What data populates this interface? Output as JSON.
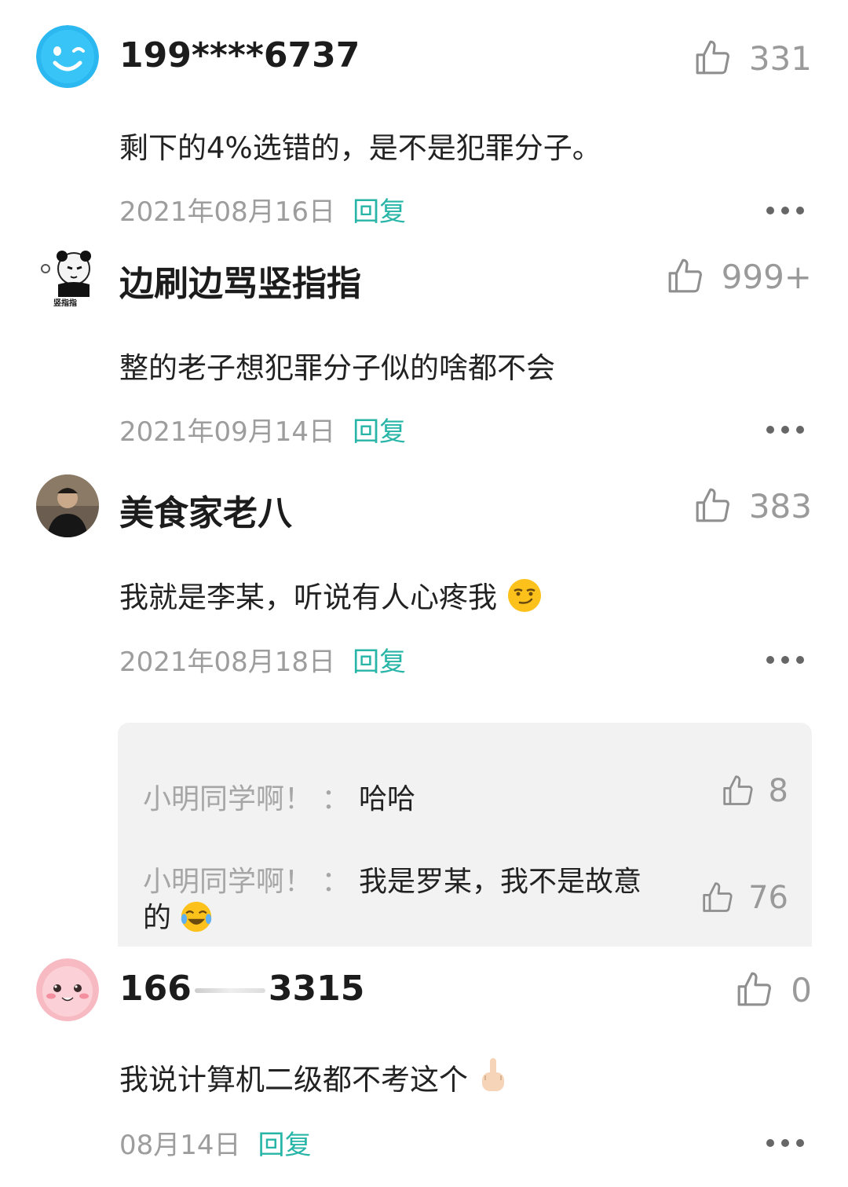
{
  "colors": {
    "reply": "#27b5a7",
    "meta": "#9d9d9d",
    "like": "#9a9a9a",
    "subbox": "#f2f2f2"
  },
  "comments": [
    {
      "username": "199****6737",
      "likes": "331",
      "text": "剩下的4%选错的，是不是犯罪分子。",
      "date": "2021年08月16日",
      "reply": "回复",
      "avatar_icon": "blue-smiley-avatar"
    },
    {
      "username": "边刷边骂竖指指",
      "likes": "999+",
      "text": "整的老子想犯罪分子似的啥都不会",
      "date": "2021年09月14日",
      "reply": "回复",
      "avatar_icon": "panda-meme-avatar",
      "avatar_caption": "竖指指"
    },
    {
      "username": "美食家老八",
      "likes": "383",
      "text": "我就是李某，听说有人心疼我",
      "date": "2021年08月18日",
      "reply": "回复",
      "avatar_icon": "photo-avatar",
      "emoji": "smirk-emoji",
      "replies": [
        {
          "name": "小明同学啊！",
          "sep": "：",
          "text": "哈哈",
          "likes": "8"
        },
        {
          "name": "小明同学啊！",
          "sep": "：",
          "text": "我是罗某，我不是故意",
          "text2": "的",
          "likes": "76",
          "emoji": "laughing-tears-emoji"
        }
      ]
    },
    {
      "username_prefix": "166",
      "username_suffix": "3315",
      "likes": "0",
      "text": "我说计算机二级都不考这个",
      "date": "08月14日",
      "reply": "回复",
      "avatar_icon": "pink-face-avatar",
      "emoji": "middle-finger-emoji"
    }
  ]
}
